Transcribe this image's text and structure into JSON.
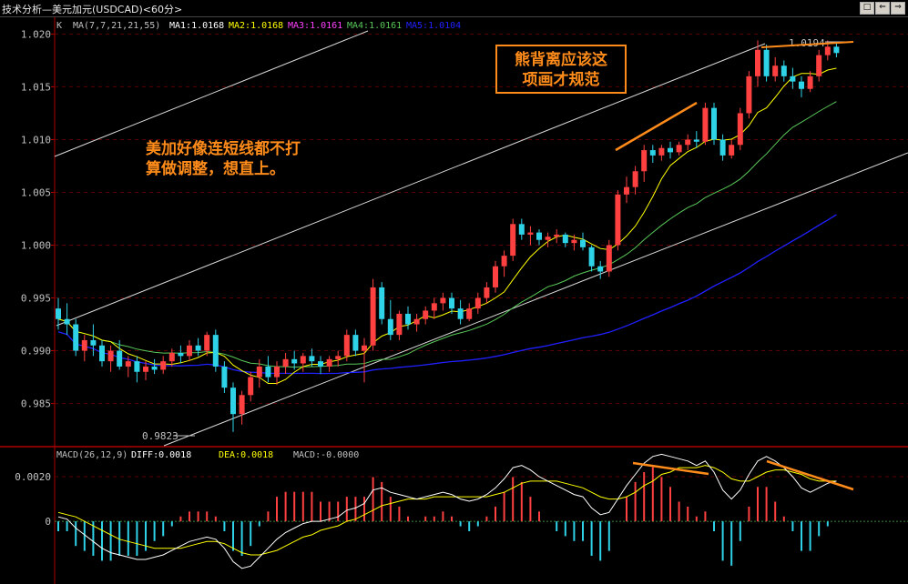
{
  "window": {
    "title": "技术分析—美元加元(USDCAD)<60分>",
    "buttons": [
      "⇐",
      "⇒",
      "□"
    ]
  },
  "colors": {
    "background": "#000000",
    "axis": "#b00000",
    "grid": "#5a0000",
    "up_candle": "#ff4040",
    "down_candle": "#2fd3e8",
    "ma1": "#ffffff",
    "ma2": "#ffff00",
    "ma3": "#ff40ff",
    "ma4": "#58c858",
    "ma5": "#2020ff",
    "channel": "#d8d8d8",
    "annotation": "#ff8c1a",
    "label_text": "#c0c0c0"
  },
  "main_panel": {
    "indicator_prefix": "K",
    "ma_params": "MA(7,7,21,21,55)",
    "ma_legend": [
      {
        "label": "MA1:1.0168",
        "color": "#ffffff"
      },
      {
        "label": "MA2:1.0168",
        "color": "#ffff00"
      },
      {
        "label": "MA3:1.0161",
        "color": "#ff40ff"
      },
      {
        "label": "MA4:1.0161",
        "color": "#58c858"
      },
      {
        "label": "MA5:1.0104",
        "color": "#2020ff"
      }
    ],
    "high_label": "1.0194",
    "low_label": "0.9823"
  },
  "macd_panel": {
    "legend": [
      {
        "label": "MACD(26,12,9)",
        "color": "#c0c0c0"
      },
      {
        "label": "DIFF:0.0018",
        "color": "#ffffff"
      },
      {
        "label": "DEA:0.0018",
        "color": "#ffff00"
      },
      {
        "label": "MACD:-0.0000",
        "color": "#c0c0c0"
      }
    ],
    "y_ticks": [
      "0.0020",
      "0"
    ]
  },
  "annotations": {
    "note_left": [
      "美加好像连短线都不打",
      "算做调整，想直上。"
    ],
    "note_box": [
      "熊背离应该这",
      "项画才规范"
    ]
  },
  "chart_data": {
    "type": "candlestick",
    "symbol": "USDCAD",
    "timeframe": "60分",
    "y_ticks": [
      "1.020",
      "1.015",
      "1.010",
      "1.005",
      "1.000",
      "0.995",
      "0.990",
      "0.985"
    ],
    "ylim": [
      0.981,
      1.0215
    ],
    "high": 1.0194,
    "low": 0.9823,
    "candles": [
      [
        0.994,
        0.995,
        0.992,
        0.993
      ],
      [
        0.993,
        0.9945,
        0.9915,
        0.9925
      ],
      [
        0.9925,
        0.993,
        0.9895,
        0.99
      ],
      [
        0.99,
        0.9915,
        0.989,
        0.991
      ],
      [
        0.991,
        0.9925,
        0.9895,
        0.9905
      ],
      [
        0.9905,
        0.991,
        0.9885,
        0.989
      ],
      [
        0.989,
        0.9905,
        0.988,
        0.99
      ],
      [
        0.99,
        0.991,
        0.9882,
        0.9885
      ],
      [
        0.9885,
        0.9895,
        0.9875,
        0.989
      ],
      [
        0.989,
        0.9895,
        0.987,
        0.988
      ],
      [
        0.988,
        0.989,
        0.9872,
        0.9885
      ],
      [
        0.9885,
        0.9892,
        0.9878,
        0.9882
      ],
      [
        0.9882,
        0.9895,
        0.9878,
        0.989
      ],
      [
        0.989,
        0.9902,
        0.9885,
        0.9898
      ],
      [
        0.9898,
        0.9905,
        0.9888,
        0.9895
      ],
      [
        0.9895,
        0.991,
        0.989,
        0.9905
      ],
      [
        0.9905,
        0.9912,
        0.9895,
        0.99
      ],
      [
        0.99,
        0.9918,
        0.9895,
        0.9915
      ],
      [
        0.9915,
        0.992,
        0.988,
        0.9885
      ],
      [
        0.9885,
        0.989,
        0.986,
        0.9865
      ],
      [
        0.9865,
        0.987,
        0.9823,
        0.984
      ],
      [
        0.984,
        0.9862,
        0.983,
        0.9858
      ],
      [
        0.9858,
        0.988,
        0.9852,
        0.9875
      ],
      [
        0.9875,
        0.9892,
        0.9865,
        0.9885
      ],
      [
        0.9885,
        0.9895,
        0.987,
        0.9875
      ],
      [
        0.9875,
        0.989,
        0.9868,
        0.9885
      ],
      [
        0.9885,
        0.9898,
        0.9878,
        0.9892
      ],
      [
        0.9892,
        0.99,
        0.9882,
        0.9888
      ],
      [
        0.9888,
        0.9898,
        0.988,
        0.9895
      ],
      [
        0.9895,
        0.9902,
        0.9885,
        0.989
      ],
      [
        0.989,
        0.9895,
        0.9878,
        0.9885
      ],
      [
        0.9885,
        0.9895,
        0.988,
        0.9892
      ],
      [
        0.9892,
        0.99,
        0.9885,
        0.9895
      ],
      [
        0.9895,
        0.992,
        0.989,
        0.9915
      ],
      [
        0.9915,
        0.992,
        0.9895,
        0.99
      ],
      [
        0.99,
        0.9912,
        0.987,
        0.9905
      ],
      [
        0.9905,
        0.9968,
        0.99,
        0.996
      ],
      [
        0.996,
        0.9965,
        0.9925,
        0.993
      ],
      [
        0.993,
        0.9948,
        0.991,
        0.9915
      ],
      [
        0.9915,
        0.9938,
        0.991,
        0.9935
      ],
      [
        0.9935,
        0.9942,
        0.992,
        0.9925
      ],
      [
        0.9925,
        0.9935,
        0.9918,
        0.993
      ],
      [
        0.993,
        0.9942,
        0.9925,
        0.9938
      ],
      [
        0.9938,
        0.995,
        0.993,
        0.9945
      ],
      [
        0.9945,
        0.9955,
        0.9938,
        0.995
      ],
      [
        0.995,
        0.9955,
        0.9935,
        0.994
      ],
      [
        0.994,
        0.9948,
        0.9925,
        0.993
      ],
      [
        0.993,
        0.9945,
        0.9928,
        0.994
      ],
      [
        0.994,
        0.9955,
        0.9935,
        0.995
      ],
      [
        0.995,
        0.9965,
        0.9945,
        0.996
      ],
      [
        0.996,
        0.9985,
        0.9955,
        0.998
      ],
      [
        0.998,
        0.9995,
        0.997,
        0.999
      ],
      [
        0.999,
        1.0025,
        0.9985,
        1.002
      ],
      [
        1.002,
        1.0025,
        1.0005,
        1.001
      ],
      [
        1.001,
        1.0018,
        1.0,
        1.0012
      ],
      [
        1.0012,
        1.0015,
        1.0,
        1.0005
      ],
      [
        1.0005,
        1.0012,
        0.9998,
        1.0008
      ],
      [
        1.0008,
        1.0015,
        1.0002,
        1.001
      ],
      [
        1.001,
        1.0012,
        0.9998,
        1.0002
      ],
      [
        1.0002,
        1.001,
        0.9995,
        1.0005
      ],
      [
        1.0005,
        1.0012,
        0.9995,
        0.9998
      ],
      [
        0.9998,
        1.0,
        0.9975,
        0.998
      ],
      [
        0.998,
        0.9985,
        0.9968,
        0.9975
      ],
      [
        0.9975,
        1.0005,
        0.997,
        1.0
      ],
      [
        1.0,
        1.0052,
        0.9995,
        1.0048
      ],
      [
        1.0048,
        1.0065,
        1.004,
        1.0055
      ],
      [
        1.0055,
        1.0075,
        1.0048,
        1.007
      ],
      [
        1.007,
        1.0095,
        1.006,
        1.009
      ],
      [
        1.009,
        1.0095,
        1.0078,
        1.0085
      ],
      [
        1.0085,
        1.0095,
        1.008,
        1.0092
      ],
      [
        1.0092,
        1.0098,
        1.0082,
        1.0088
      ],
      [
        1.0088,
        1.0098,
        1.0085,
        1.0095
      ],
      [
        1.0095,
        1.0105,
        1.009,
        1.01
      ],
      [
        1.01,
        1.0108,
        1.0092,
        1.0098
      ],
      [
        1.0098,
        1.0135,
        1.0095,
        1.013
      ],
      [
        1.013,
        1.0135,
        1.0095,
        1.01
      ],
      [
        1.01,
        1.0105,
        1.008,
        1.0085
      ],
      [
        1.0085,
        1.01,
        1.0082,
        1.0095
      ],
      [
        1.0095,
        1.013,
        1.009,
        1.0125
      ],
      [
        1.0125,
        1.0165,
        1.012,
        1.016
      ],
      [
        1.016,
        1.0194,
        1.015,
        1.0185
      ],
      [
        1.0185,
        1.019,
        1.0155,
        1.016
      ],
      [
        1.016,
        1.0178,
        1.0155,
        1.017
      ],
      [
        1.017,
        1.0175,
        1.0155,
        1.016
      ],
      [
        1.016,
        1.0168,
        1.0148,
        1.0155
      ],
      [
        1.0155,
        1.016,
        1.014,
        1.0148
      ],
      [
        1.0148,
        1.0165,
        1.0145,
        1.016
      ],
      [
        1.016,
        1.0185,
        1.0155,
        1.018
      ],
      [
        1.018,
        1.0194,
        1.0175,
        1.0188
      ],
      [
        1.0188,
        1.0192,
        1.0178,
        1.0182
      ]
    ],
    "macd": {
      "y_tick_values": [
        0.002,
        0
      ],
      "ylim": [
        -0.0028,
        0.0033
      ],
      "diff": [
        0.0002,
        0.0001,
        -0.0003,
        -0.0006,
        -0.0009,
        -0.0012,
        -0.0014,
        -0.0015,
        -0.0016,
        -0.0017,
        -0.0017,
        -0.0016,
        -0.0015,
        -0.0013,
        -0.0011,
        -0.0009,
        -0.0008,
        -0.0007,
        -0.0008,
        -0.0012,
        -0.0018,
        -0.0021,
        -0.002,
        -0.0016,
        -0.0012,
        -0.0008,
        -0.0005,
        -0.0003,
        -0.0001,
        0.0,
        0.0,
        0.0001,
        0.0002,
        0.0005,
        0.0006,
        0.0008,
        0.0014,
        0.0015,
        0.0013,
        0.0012,
        0.0011,
        0.001,
        0.0011,
        0.0012,
        0.0013,
        0.0012,
        0.001,
        0.0009,
        0.001,
        0.0012,
        0.0015,
        0.0019,
        0.0024,
        0.0025,
        0.0023,
        0.002,
        0.0018,
        0.0016,
        0.0014,
        0.0012,
        0.0011,
        0.0006,
        0.0003,
        0.0004,
        0.001,
        0.0016,
        0.0021,
        0.0026,
        0.0029,
        0.003,
        0.0029,
        0.0028,
        0.0027,
        0.0025,
        0.0027,
        0.0022,
        0.0014,
        0.001,
        0.0014,
        0.0021,
        0.0027,
        0.0029,
        0.0027,
        0.0024,
        0.002,
        0.0015,
        0.0013,
        0.0015,
        0.0017,
        0.0018
      ],
      "dea": [
        0.0004,
        0.0003,
        0.0002,
        0.0,
        -0.0002,
        -0.0004,
        -0.0006,
        -0.0008,
        -0.0009,
        -0.001,
        -0.0011,
        -0.0012,
        -0.0012,
        -0.0012,
        -0.0012,
        -0.0011,
        -0.001,
        -0.0009,
        -0.0009,
        -0.001,
        -0.0012,
        -0.0014,
        -0.0015,
        -0.0015,
        -0.0014,
        -0.0013,
        -0.0011,
        -0.0009,
        -0.0007,
        -0.0006,
        -0.0004,
        -0.0003,
        -0.0002,
        0.0,
        0.0001,
        0.0003,
        0.0005,
        0.0007,
        0.0008,
        0.0009,
        0.001,
        0.001,
        0.001,
        0.0011,
        0.0011,
        0.0011,
        0.0011,
        0.0011,
        0.0011,
        0.0011,
        0.0012,
        0.0013,
        0.0015,
        0.0017,
        0.0018,
        0.0018,
        0.0018,
        0.0018,
        0.0017,
        0.0016,
        0.0015,
        0.0013,
        0.0011,
        0.001,
        0.001,
        0.0011,
        0.0013,
        0.0016,
        0.0018,
        0.0021,
        0.0022,
        0.0024,
        0.0024,
        0.0024,
        0.0025,
        0.0024,
        0.0022,
        0.0019,
        0.0018,
        0.0018,
        0.002,
        0.0022,
        0.0023,
        0.0023,
        0.0022,
        0.0021,
        0.0019,
        0.0018,
        0.0018,
        0.0018
      ]
    }
  }
}
